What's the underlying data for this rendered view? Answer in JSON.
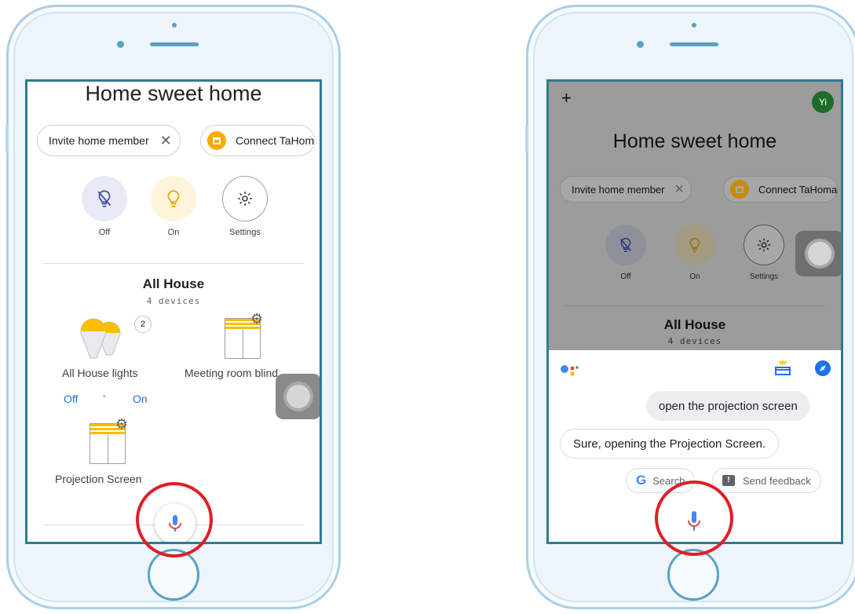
{
  "left_screen": {
    "title": "Home sweet home",
    "chip_invite": "Invite home member",
    "chip_invite_close": "✕",
    "chip_connect": "Connect TaHom",
    "quick_actions": [
      {
        "label": "Off",
        "icon": "bulb-off-icon"
      },
      {
        "label": "On",
        "icon": "bulb-on-icon"
      },
      {
        "label": "Settings",
        "icon": "gear-icon"
      }
    ],
    "room_name": "All House",
    "room_devices": "4 devices",
    "lights_label": "All House lights",
    "lights_count": "2",
    "lights_off": "Off",
    "lights_sep": "•",
    "lights_on": "On",
    "blind_label": "Meeting room blind",
    "projection_label": "Projection Screen"
  },
  "right_screen": {
    "plus": "+",
    "avatar": "Yi",
    "title": "Home sweet home",
    "chip_invite": "Invite home member",
    "chip_invite_close": "✕",
    "chip_connect": "Connect TaHoma",
    "quick_actions": [
      {
        "label": "Off",
        "icon": "bulb-off-icon"
      },
      {
        "label": "On",
        "icon": "bulb-on-icon"
      },
      {
        "label": "Settings",
        "icon": "gear-icon"
      }
    ],
    "room_name": "All House",
    "room_devices": "4 devices",
    "user_query": "open the projection screen",
    "assistant_reply": "Sure, opening the Projection Screen.",
    "search_label": "Search",
    "feedback_label": "Send feedback"
  },
  "colors": {
    "accent_blue": "#1a73e8",
    "highlight_red": "#e01e26",
    "bulb_yellow": "#fbbc04",
    "frame_blue": "#5aa1c6"
  }
}
